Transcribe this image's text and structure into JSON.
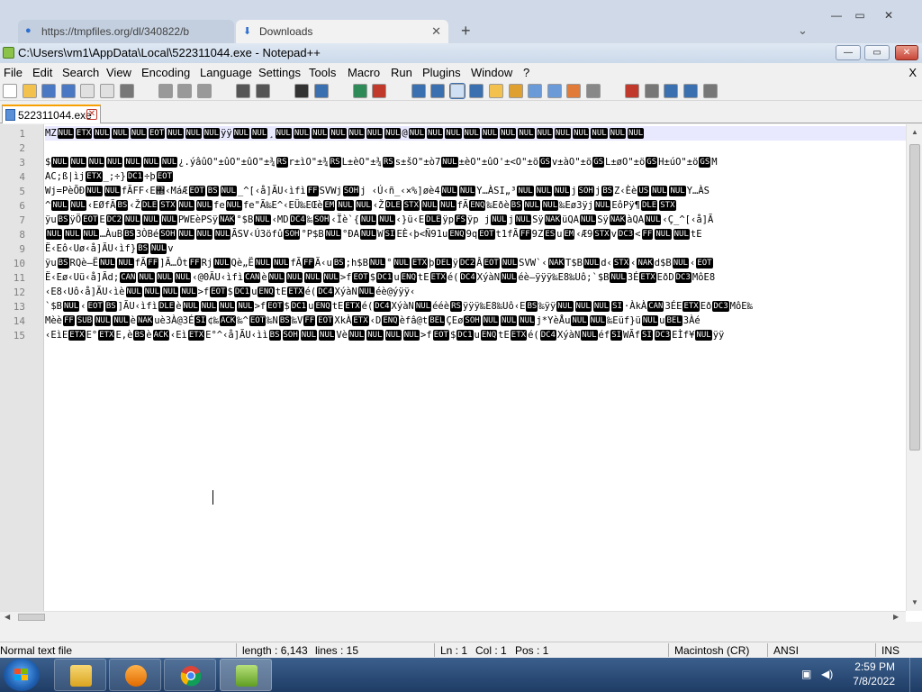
{
  "browser": {
    "tabs": [
      {
        "label": "https://tmpfiles.org/dl/340822/b"
      },
      {
        "label": "Downloads"
      }
    ],
    "new_tab": "+"
  },
  "window": {
    "title": "C:\\Users\\vm1\\AppData\\Local\\522311044.exe - Notepad++",
    "controls": {
      "minimize": "—",
      "maximize": "▭",
      "close": "✕"
    }
  },
  "menu": {
    "items": [
      "File",
      "Edit",
      "Search",
      "View",
      "Encoding",
      "Language",
      "Settings",
      "Tools",
      "Macro",
      "Run",
      "Plugins",
      "Window",
      "?"
    ],
    "close_x": "X"
  },
  "toolbar": {
    "icons": [
      "new-file-icon",
      "open-file-icon",
      "save-icon",
      "save-all-icon",
      "close-icon",
      "close-all-icon",
      "print-icon",
      "cut-icon",
      "copy-icon",
      "paste-icon",
      "undo-icon",
      "redo-icon",
      "find-icon",
      "replace-icon",
      "zoom-in-icon",
      "zoom-out-icon",
      "sync-v-icon",
      "sync-h-icon",
      "word-wrap-icon",
      "show-all-chars-icon",
      "indent-guide-icon",
      "udl-icon",
      "doc-map-icon",
      "function-list-icon",
      "folder-workspace-icon",
      "monitoring-icon",
      "record-macro-icon",
      "stop-macro-icon",
      "play-macro-icon",
      "run-macro-multiple-icon",
      "save-macro-icon"
    ]
  },
  "document_tab": {
    "label": "522311044.exe"
  },
  "editor": {
    "line_numbers": [
      "1",
      "2",
      "3",
      "4",
      "5",
      "6",
      "7",
      "8",
      "9",
      "10",
      "11",
      "12",
      "13",
      "14",
      "15"
    ],
    "lines": [
      [
        {
          "t": "MZ"
        },
        {
          "c": "NUL"
        },
        {
          "c": "ETX"
        },
        {
          "c": "NUL"
        },
        {
          "c": "NUL"
        },
        {
          "c": "NUL"
        },
        {
          "c": "EOT"
        },
        {
          "c": "NUL"
        },
        {
          "c": "NUL"
        },
        {
          "c": "NUL"
        },
        {
          "t": "ÿÿ"
        },
        {
          "c": "NUL"
        },
        {
          "c": "NUL"
        },
        {
          "t": "¸"
        },
        {
          "c": "NUL"
        },
        {
          "c": "NUL"
        },
        {
          "c": "NUL"
        },
        {
          "c": "NUL"
        },
        {
          "c": "NUL"
        },
        {
          "c": "NUL"
        },
        {
          "c": "NUL"
        },
        {
          "t": "@"
        },
        {
          "c": "NUL"
        },
        {
          "c": "NUL"
        },
        {
          "c": "NUL"
        },
        {
          "c": "NUL"
        },
        {
          "c": "NUL"
        },
        {
          "c": "NUL"
        },
        {
          "c": "NUL"
        },
        {
          "c": "NUL"
        },
        {
          "c": "NUL"
        },
        {
          "c": "NUL"
        },
        {
          "c": "NUL"
        },
        {
          "c": "NUL"
        },
        {
          "c": "NUL"
        }
      ],
      [],
      [
        {
          "t": "$"
        },
        {
          "c": "NUL"
        },
        {
          "c": "NUL"
        },
        {
          "c": "NUL"
        },
        {
          "c": "NUL"
        },
        {
          "c": "NUL"
        },
        {
          "c": "NUL"
        },
        {
          "c": "NUL"
        },
        {
          "t": "¿.ýâûO\"±ûO\"±ûO\"±¾"
        },
        {
          "c": "RS"
        },
        {
          "t": "r±ìO\"±¾"
        },
        {
          "c": "RS"
        },
        {
          "t": "L±èO\"±¾"
        },
        {
          "c": "RS"
        },
        {
          "t": "s±šO\"±ò7"
        },
        {
          "c": "NUL"
        },
        {
          "t": "±èO\"±ûO'±<O\"±ö"
        },
        {
          "c": "GS"
        },
        {
          "t": "v±àO\"±ö"
        },
        {
          "c": "GS"
        },
        {
          "t": "L±øO\"±ö"
        },
        {
          "c": "GS"
        },
        {
          "t": "H±úO\"±ö"
        },
        {
          "c": "GS"
        },
        {
          "t": "M"
        }
      ],
      [
        {
          "t": "AC;ß|ìj"
        },
        {
          "c": "ETX"
        },
        {
          "t": "_;÷}"
        },
        {
          "c": "DC1"
        },
        {
          "t": "÷þ"
        },
        {
          "c": "EOT"
        }
      ],
      [
        {
          "t": "Wj=PèÕÐ"
        },
        {
          "c": "NUL"
        },
        {
          "c": "NUL"
        },
        {
          "t": "fÃFF‹E΍‹MáÆ"
        },
        {
          "c": "EOT"
        },
        {
          "c": "BS"
        },
        {
          "c": "NUL"
        },
        {
          "t": "_^[‹å]ÃU‹ìfì"
        },
        {
          "c": "FF"
        },
        {
          "t": "SVWj"
        },
        {
          "c": "SOH"
        },
        {
          "t": "j ‹Ú‹ñ_‹×%]øè4"
        },
        {
          "c": "NUL"
        },
        {
          "c": "NUL"
        },
        {
          "t": "Y…ÀSI„³"
        },
        {
          "c": "NUL"
        },
        {
          "c": "NUL"
        },
        {
          "c": "NUL"
        },
        {
          "t": "j"
        },
        {
          "c": "SOH"
        },
        {
          "t": "j"
        },
        {
          "c": "BS"
        },
        {
          "t": "Z‹Èè"
        },
        {
          "c": "US"
        },
        {
          "c": "NUL"
        },
        {
          "c": "NUL"
        },
        {
          "t": "Y…ÀS"
        }
      ],
      [
        {
          "t": "^"
        },
        {
          "c": "NUL"
        },
        {
          "c": "NUL"
        },
        {
          "t": "‹EØfÃ"
        },
        {
          "c": "BS"
        },
        {
          "t": "‹Ž"
        },
        {
          "c": "DLE"
        },
        {
          "c": "STX"
        },
        {
          "c": "NUL"
        },
        {
          "c": "NUL"
        },
        {
          "t": "fe"
        },
        {
          "c": "NUL"
        },
        {
          "t": "fe\"Ã‰E^‹EÜ‰EŒè"
        },
        {
          "c": "EM"
        },
        {
          "c": "NUL"
        },
        {
          "c": "NUL"
        },
        {
          "t": "‹Ž"
        },
        {
          "c": "DLE"
        },
        {
          "c": "STX"
        },
        {
          "c": "NUL"
        },
        {
          "c": "NUL"
        },
        {
          "t": "fÃ"
        },
        {
          "c": "ENQ"
        },
        {
          "t": "‰Eðè"
        },
        {
          "c": "BS"
        },
        {
          "c": "NUL"
        },
        {
          "c": "NUL"
        },
        {
          "t": "‰Eø3ÿj"
        },
        {
          "c": "NUL"
        },
        {
          "t": "EôPÿ¶"
        },
        {
          "c": "DLE"
        },
        {
          "c": "STX"
        }
      ],
      [
        {
          "t": "ÿu"
        },
        {
          "c": "BS"
        },
        {
          "t": "ÿÖ"
        },
        {
          "c": "EOT"
        },
        {
          "t": "E"
        },
        {
          "c": "DC2"
        },
        {
          "c": "NUL"
        },
        {
          "c": "NUL"
        },
        {
          "c": "NUL"
        },
        {
          "t": "PWEèPSÿ"
        },
        {
          "c": "NAK"
        },
        {
          "t": "°$B"
        },
        {
          "c": "NUL"
        },
        {
          "t": "‹MD"
        },
        {
          "c": "DC4"
        },
        {
          "t": "‰"
        },
        {
          "c": "SOH"
        },
        {
          "t": "‹Ïè`{"
        },
        {
          "c": "NUL"
        },
        {
          "c": "NUL"
        },
        {
          "t": "‹}ü‹E"
        },
        {
          "c": "DLE"
        },
        {
          "t": "ÿp"
        },
        {
          "c": "FS"
        },
        {
          "t": "ÿp j"
        },
        {
          "c": "NUL"
        },
        {
          "t": "j"
        },
        {
          "c": "NUL"
        },
        {
          "t": "Sÿ"
        },
        {
          "c": "NAK"
        },
        {
          "t": "üQA"
        },
        {
          "c": "NUL"
        },
        {
          "t": "Sÿ"
        },
        {
          "c": "NAK"
        },
        {
          "t": "àQA"
        },
        {
          "c": "NUL"
        },
        {
          "t": "‹Ç_^[‹å]Ã"
        }
      ],
      [
        {
          "c": "NUL"
        },
        {
          "c": "NUL"
        },
        {
          "c": "NUL"
        },
        {
          "t": "…ÀuB"
        },
        {
          "c": "BS"
        },
        {
          "t": "3ÒBé"
        },
        {
          "c": "SOH"
        },
        {
          "c": "NUL"
        },
        {
          "c": "NUL"
        },
        {
          "c": "NUL"
        },
        {
          "t": "ÃSV‹Ú3öfû"
        },
        {
          "c": "SOH"
        },
        {
          "t": "°P$B"
        },
        {
          "c": "NUL"
        },
        {
          "t": "°ÐA"
        },
        {
          "c": "NUL"
        },
        {
          "t": "W"
        },
        {
          "c": "SI"
        },
        {
          "t": "EÈ‹þ<Ñ91u"
        },
        {
          "c": "ENQ"
        },
        {
          "t": "9q"
        },
        {
          "c": "EOT"
        },
        {
          "t": "t1fÃ"
        },
        {
          "c": "FF"
        },
        {
          "t": "9Z"
        },
        {
          "c": "ES"
        },
        {
          "t": "u"
        },
        {
          "c": "EM"
        },
        {
          "t": "‹Æ9"
        },
        {
          "c": "STX"
        },
        {
          "t": "v"
        },
        {
          "c": "DC3"
        },
        {
          "t": "<"
        },
        {
          "c": "FF"
        },
        {
          "c": "NUL"
        },
        {
          "c": "NUL"
        },
        {
          "t": "tE"
        }
      ],
      [
        {
          "t": "Ë‹Eô‹Uø‹å]ÃU‹ìf}"
        },
        {
          "c": "BS"
        },
        {
          "c": "NUL"
        },
        {
          "t": "v"
        }
      ],
      [
        {
          "t": "ÿu"
        },
        {
          "c": "BS"
        },
        {
          "t": "RQè–Ë"
        },
        {
          "c": "NUL"
        },
        {
          "c": "NUL"
        },
        {
          "t": "fÃ"
        },
        {
          "c": "FF"
        },
        {
          "t": "]Ã…Ôt"
        },
        {
          "c": "FF"
        },
        {
          "t": "Rj"
        },
        {
          "c": "NUL"
        },
        {
          "t": "Qè„Ë"
        },
        {
          "c": "NUL"
        },
        {
          "c": "NUL"
        },
        {
          "t": "fÃ"
        },
        {
          "c": "FF"
        },
        {
          "t": "Ã‹u"
        },
        {
          "c": "BS"
        },
        {
          "t": ";h$B"
        },
        {
          "c": "NUL"
        },
        {
          "t": "°"
        },
        {
          "c": "NUL"
        },
        {
          "c": "ETX"
        },
        {
          "t": "þ"
        },
        {
          "c": "DEL"
        },
        {
          "t": "ÿ"
        },
        {
          "c": "DC2"
        },
        {
          "t": "Â"
        },
        {
          "c": "EOT"
        },
        {
          "c": "NUL"
        },
        {
          "t": "SVW`‹"
        },
        {
          "c": "NAK"
        },
        {
          "t": "T$B"
        },
        {
          "c": "NUL"
        },
        {
          "t": "d‹"
        },
        {
          "c": "STX"
        },
        {
          "t": "‹"
        },
        {
          "c": "NAK"
        },
        {
          "t": "d$B"
        },
        {
          "c": "NUL"
        },
        {
          "t": "‹"
        },
        {
          "c": "EOT"
        }
      ],
      [
        {
          "t": "Ë‹Eø‹Uü‹å]Ãd;"
        },
        {
          "c": "CAN"
        },
        {
          "c": "NUL"
        },
        {
          "c": "NUL"
        },
        {
          "c": "NUL"
        },
        {
          "t": "‹@0ÃU‹ìfì"
        },
        {
          "c": "CAN"
        },
        {
          "t": "è"
        },
        {
          "c": "NUL"
        },
        {
          "c": "NUL"
        },
        {
          "c": "NUL"
        },
        {
          "c": "NUL"
        },
        {
          "t": ">f"
        },
        {
          "c": "EOT"
        },
        {
          "t": "$"
        },
        {
          "c": "DC1"
        },
        {
          "t": "u"
        },
        {
          "c": "ENQ"
        },
        {
          "t": "tE"
        },
        {
          "c": "ETX"
        },
        {
          "t": "é("
        },
        {
          "c": "DC4"
        },
        {
          "t": "XýàN"
        },
        {
          "c": "NUL"
        },
        {
          "t": "éè–ÿÿÿ‰E8‰Uô;`$B"
        },
        {
          "c": "NUL"
        },
        {
          "t": "3É"
        },
        {
          "c": "ETX"
        },
        {
          "t": "EðD"
        },
        {
          "c": "DC3"
        },
        {
          "t": "MôE8"
        }
      ],
      [
        {
          "t": "‹E8‹Uô‹å]ÃU‹ìè"
        },
        {
          "c": "NUL"
        },
        {
          "c": "NUL"
        },
        {
          "c": "NUL"
        },
        {
          "c": "NUL"
        },
        {
          "t": ">f"
        },
        {
          "c": "EOT"
        },
        {
          "t": "$"
        },
        {
          "c": "DC1"
        },
        {
          "t": "u"
        },
        {
          "c": "ENQ"
        },
        {
          "t": "tE"
        },
        {
          "c": "ETX"
        },
        {
          "t": "é("
        },
        {
          "c": "DC4"
        },
        {
          "t": "XýàN"
        },
        {
          "c": "NUL"
        },
        {
          "t": "éè@ýÿÿ‹"
        }
      ],
      [
        {
          "t": "`$B"
        },
        {
          "c": "NUL"
        },
        {
          "t": "‹"
        },
        {
          "c": "EOT"
        },
        {
          "c": "BS"
        },
        {
          "t": "]ÃU‹ìfì"
        },
        {
          "c": "DLE"
        },
        {
          "t": "è"
        },
        {
          "c": "NUL"
        },
        {
          "c": "NUL"
        },
        {
          "c": "NUL"
        },
        {
          "c": "NUL"
        },
        {
          "t": ">f"
        },
        {
          "c": "EOT"
        },
        {
          "t": "$"
        },
        {
          "c": "DC1"
        },
        {
          "t": "u"
        },
        {
          "c": "ENQ"
        },
        {
          "t": "tE"
        },
        {
          "c": "ETX"
        },
        {
          "t": "é("
        },
        {
          "c": "DC4"
        },
        {
          "t": "XýàN"
        },
        {
          "c": "NUL"
        },
        {
          "t": "ééè"
        },
        {
          "c": "RS"
        },
        {
          "t": "ÿÿÿ‰E8‰Uô‹E"
        },
        {
          "c": "BS"
        },
        {
          "t": "‰ÿÿ"
        },
        {
          "c": "NUL"
        },
        {
          "c": "NUL"
        },
        {
          "c": "NUL"
        },
        {
          "c": "SI"
        },
        {
          "t": "·ÀkÀ"
        },
        {
          "c": "CAN"
        },
        {
          "t": "3ÉE"
        },
        {
          "c": "ETX"
        },
        {
          "t": "Eð"
        },
        {
          "c": "DC3"
        },
        {
          "t": "MôE‰"
        }
      ],
      [
        {
          "t": "Mèè"
        },
        {
          "c": "FF"
        },
        {
          "c": "SUB"
        },
        {
          "c": "NUL"
        },
        {
          "c": "NUL"
        },
        {
          "t": "è"
        },
        {
          "c": "NAK"
        },
        {
          "t": "uè3À@3É"
        },
        {
          "c": "SI"
        },
        {
          "t": "¢‰"
        },
        {
          "c": "ACK"
        },
        {
          "t": "‰^"
        },
        {
          "c": "EOT"
        },
        {
          "t": "‰N"
        },
        {
          "c": "BS"
        },
        {
          "t": "‰V"
        },
        {
          "c": "FF"
        },
        {
          "c": "EOT"
        },
        {
          "t": "XkÀ"
        },
        {
          "c": "ETX"
        },
        {
          "t": "‹D"
        },
        {
          "c": "ENQ"
        },
        {
          "t": "èfâ@t"
        },
        {
          "c": "BEL"
        },
        {
          "t": "ÇEø"
        },
        {
          "c": "SOH"
        },
        {
          "c": "NUL"
        },
        {
          "c": "NUL"
        },
        {
          "c": "NUL"
        },
        {
          "t": "j*YèÅu"
        },
        {
          "c": "NUL"
        },
        {
          "c": "NUL"
        },
        {
          "t": "‰Eüf}ü"
        },
        {
          "c": "NUL"
        },
        {
          "t": "u"
        },
        {
          "c": "BEL"
        },
        {
          "t": "3Àé"
        }
      ],
      [
        {
          "t": "‹EìE"
        },
        {
          "c": "ETX"
        },
        {
          "t": "E°"
        },
        {
          "c": "ETX"
        },
        {
          "t": "E,è"
        },
        {
          "c": "BS"
        },
        {
          "t": "è"
        },
        {
          "c": "ACK"
        },
        {
          "t": "‹Eì"
        },
        {
          "c": "ETX"
        },
        {
          "t": "E°^‹å]ÃU‹ìì"
        },
        {
          "c": "BS"
        },
        {
          "c": "SOH"
        },
        {
          "c": "NUL"
        },
        {
          "c": "NUL"
        },
        {
          "t": "Vè"
        },
        {
          "c": "NUL"
        },
        {
          "c": "NUL"
        },
        {
          "c": "NUL"
        },
        {
          "c": "NUL"
        },
        {
          "t": ">f"
        },
        {
          "c": "EOT"
        },
        {
          "t": "$"
        },
        {
          "c": "DC1"
        },
        {
          "t": "u"
        },
        {
          "c": "ENQ"
        },
        {
          "t": "tE"
        },
        {
          "c": "ETX"
        },
        {
          "t": "é("
        },
        {
          "c": "DC4"
        },
        {
          "t": "XýàN"
        },
        {
          "c": "NUL"
        },
        {
          "t": "éf"
        },
        {
          "c": "SI"
        },
        {
          "t": "WÃf"
        },
        {
          "c": "SI"
        },
        {
          "c": "DC3"
        },
        {
          "t": "EÌf¥"
        },
        {
          "c": "NUL"
        },
        {
          "t": "ÿÿ"
        }
      ]
    ]
  },
  "status": {
    "file_type": "Normal text file",
    "length": "length : 6,143",
    "lines": "lines : 15",
    "ln": "Ln : 1",
    "col": "Col : 1",
    "pos": "Pos : 1",
    "eol": "Macintosh (CR)",
    "encoding": "ANSI",
    "mode": "INS"
  },
  "taskbar": {
    "apps": [
      "explorer-icon",
      "media-player-icon",
      "chrome-icon",
      "notepadpp-icon"
    ],
    "time": "2:59 PM",
    "date": "7/8/2022"
  }
}
